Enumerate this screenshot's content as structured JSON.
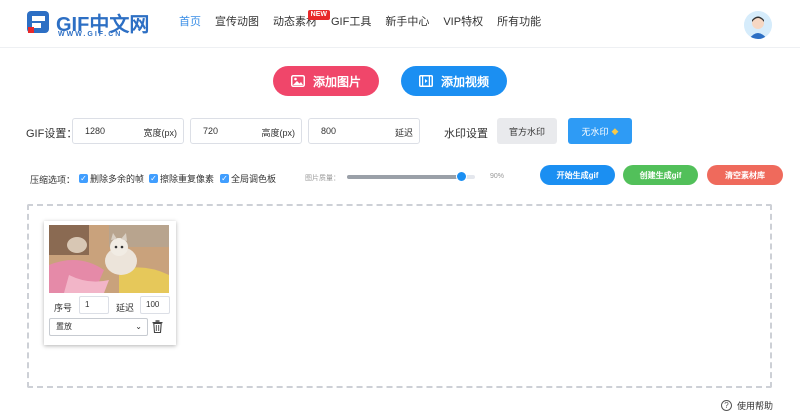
{
  "header": {
    "logo_text": "GIF中文网",
    "logo_sub": "WWW.GIF.CN",
    "nav": [
      {
        "label": "首页",
        "active": true
      },
      {
        "label": "宣传动图"
      },
      {
        "label": "动态素材",
        "badge": "NEW"
      },
      {
        "label": "GIF工具"
      },
      {
        "label": "新手中心"
      },
      {
        "label": "VIP特权"
      },
      {
        "label": "所有功能"
      }
    ]
  },
  "actions": {
    "add_image": "添加图片",
    "add_video": "添加视频"
  },
  "gif_settings": {
    "label": "GIF设置：",
    "width": {
      "value": "1280",
      "unit": "宽度(px)"
    },
    "height": {
      "value": "720",
      "unit": "高度(px)"
    },
    "delay": {
      "value": "800",
      "unit": "延迟"
    }
  },
  "watermark": {
    "label": "水印设置",
    "official": "官方水印",
    "none": "无水印"
  },
  "compression": {
    "label": "压缩选项：",
    "options": [
      {
        "label": "删除多余的帧",
        "checked": true
      },
      {
        "label": "擦除重复像素",
        "checked": true
      },
      {
        "label": "全局调色板",
        "checked": true
      }
    ],
    "quality_label": "图片质量：",
    "quality_value": 0.9,
    "quality_text": "90%"
  },
  "buttons": {
    "start": "开始生成gif",
    "create": "创建生成gif",
    "clear": "清空素材库"
  },
  "frame_card": {
    "index_label": "序号",
    "index_value": "1",
    "delay_label": "延迟",
    "delay_value": "100",
    "position_select": "置放"
  },
  "footer": {
    "help": "使用帮助"
  },
  "colors": {
    "primary": "#1b8ff2",
    "pink": "#f0466a",
    "green": "#52c05a",
    "red": "#ef6a5c"
  }
}
